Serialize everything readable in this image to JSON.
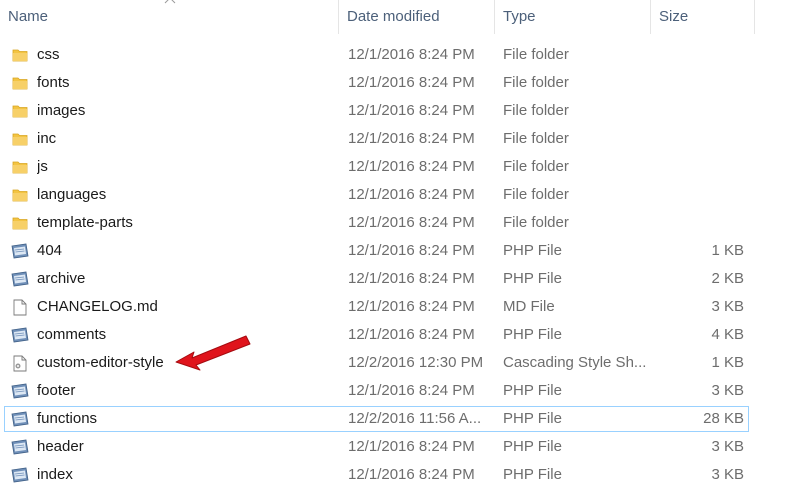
{
  "columns": {
    "name": "Name",
    "date": "Date modified",
    "type": "Type",
    "size": "Size"
  },
  "files": [
    {
      "name": "css",
      "date": "12/1/2016 8:24 PM",
      "type": "File folder",
      "size": "",
      "icon": "folder-icon"
    },
    {
      "name": "fonts",
      "date": "12/1/2016 8:24 PM",
      "type": "File folder",
      "size": "",
      "icon": "folder-icon"
    },
    {
      "name": "images",
      "date": "12/1/2016 8:24 PM",
      "type": "File folder",
      "size": "",
      "icon": "folder-icon"
    },
    {
      "name": "inc",
      "date": "12/1/2016 8:24 PM",
      "type": "File folder",
      "size": "",
      "icon": "folder-icon"
    },
    {
      "name": "js",
      "date": "12/1/2016 8:24 PM",
      "type": "File folder",
      "size": "",
      "icon": "folder-icon"
    },
    {
      "name": "languages",
      "date": "12/1/2016 8:24 PM",
      "type": "File folder",
      "size": "",
      "icon": "folder-icon"
    },
    {
      "name": "template-parts",
      "date": "12/1/2016 8:24 PM",
      "type": "File folder",
      "size": "",
      "icon": "folder-icon"
    },
    {
      "name": "404",
      "date": "12/1/2016 8:24 PM",
      "type": "PHP File",
      "size": "1 KB",
      "icon": "php-file-icon"
    },
    {
      "name": "archive",
      "date": "12/1/2016 8:24 PM",
      "type": "PHP File",
      "size": "2 KB",
      "icon": "php-file-icon"
    },
    {
      "name": "CHANGELOG.md",
      "date": "12/1/2016 8:24 PM",
      "type": "MD File",
      "size": "3 KB",
      "icon": "blank-file-icon"
    },
    {
      "name": "comments",
      "date": "12/1/2016 8:24 PM",
      "type": "PHP File",
      "size": "4 KB",
      "icon": "php-file-icon"
    },
    {
      "name": "custom-editor-style",
      "date": "12/2/2016 12:30 PM",
      "type": "Cascading Style Sh...",
      "size": "1 KB",
      "icon": "css-file-icon"
    },
    {
      "name": "footer",
      "date": "12/1/2016 8:24 PM",
      "type": "PHP File",
      "size": "3 KB",
      "icon": "php-file-icon"
    },
    {
      "name": "functions",
      "date": "12/2/2016 11:56 A...",
      "type": "PHP File",
      "size": "28 KB",
      "icon": "php-file-icon",
      "selected": true
    },
    {
      "name": "header",
      "date": "12/1/2016 8:24 PM",
      "type": "PHP File",
      "size": "3 KB",
      "icon": "php-file-icon"
    },
    {
      "name": "index",
      "date": "12/1/2016 8:24 PM",
      "type": "PHP File",
      "size": "3 KB",
      "icon": "php-file-icon"
    }
  ],
  "colors": {
    "folder": "#f3c443",
    "selection_border": "#99d1ff",
    "annotation_arrow": "#e0141c"
  },
  "annotation_icon": "red-arrow-icon"
}
